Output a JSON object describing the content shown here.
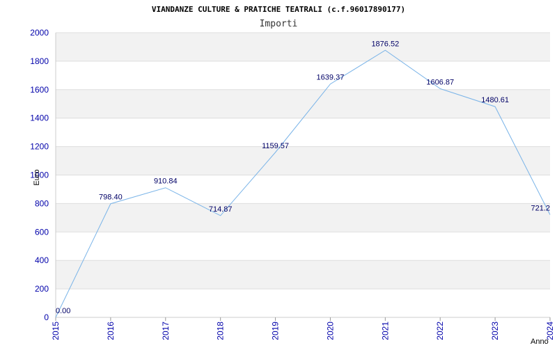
{
  "chart_data": {
    "type": "line",
    "title": "VIANDANZE CULTURE & PRATICHE TEATRALI (c.f.96017890177)",
    "subtitle": "Importi",
    "ylabel": "Euro",
    "xlabel": "Anno",
    "ylim": [
      0,
      2000
    ],
    "yticks": [
      "0",
      "200",
      "400",
      "600",
      "800",
      "1000",
      "1200",
      "1400",
      "1600",
      "1800",
      "2000"
    ],
    "categories": [
      "2015",
      "2016",
      "2017",
      "2018",
      "2019",
      "2020",
      "2021",
      "2022",
      "2023",
      "2024"
    ],
    "values": [
      0.0,
      798.4,
      910.84,
      714.87,
      1159.57,
      1639.37,
      1876.52,
      1606.87,
      1480.61,
      721.2
    ],
    "value_labels": [
      "0.00",
      "798.40",
      "910.84",
      "714.87",
      "1159.57",
      "1639.37",
      "1876.52",
      "1606.87",
      "1480.61",
      "721.2"
    ],
    "grid": true,
    "line_color": "#7ab4e8",
    "band_color": "#f2f2f2"
  }
}
